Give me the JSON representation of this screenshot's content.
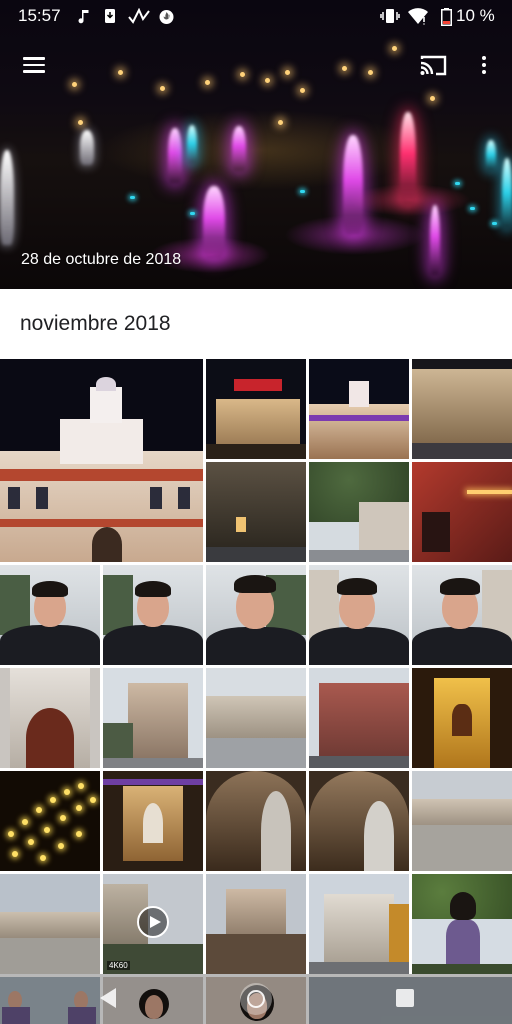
{
  "status_bar": {
    "time": "15:57",
    "notification_icons": [
      "music-note-icon",
      "download-icon",
      "signal-check-icon",
      "fire-icon"
    ],
    "system_icons": [
      "vibrate-icon",
      "wifi-icon",
      "battery-icon"
    ],
    "battery": "10 %"
  },
  "toolbar": {
    "menu_icon": "menu-icon",
    "cast_icon": "cast-icon",
    "more_icon": "more-vert-icon"
  },
  "hero": {
    "date": "28 de octubre de 2018"
  },
  "section": {
    "month": "noviembre 2018"
  },
  "grid": {
    "video_badge": "4K60",
    "play_icon": "play-icon"
  },
  "nav_bar": {
    "back_icon": "back-icon",
    "home_icon": "home-icon",
    "recents_icon": "recents-icon"
  }
}
